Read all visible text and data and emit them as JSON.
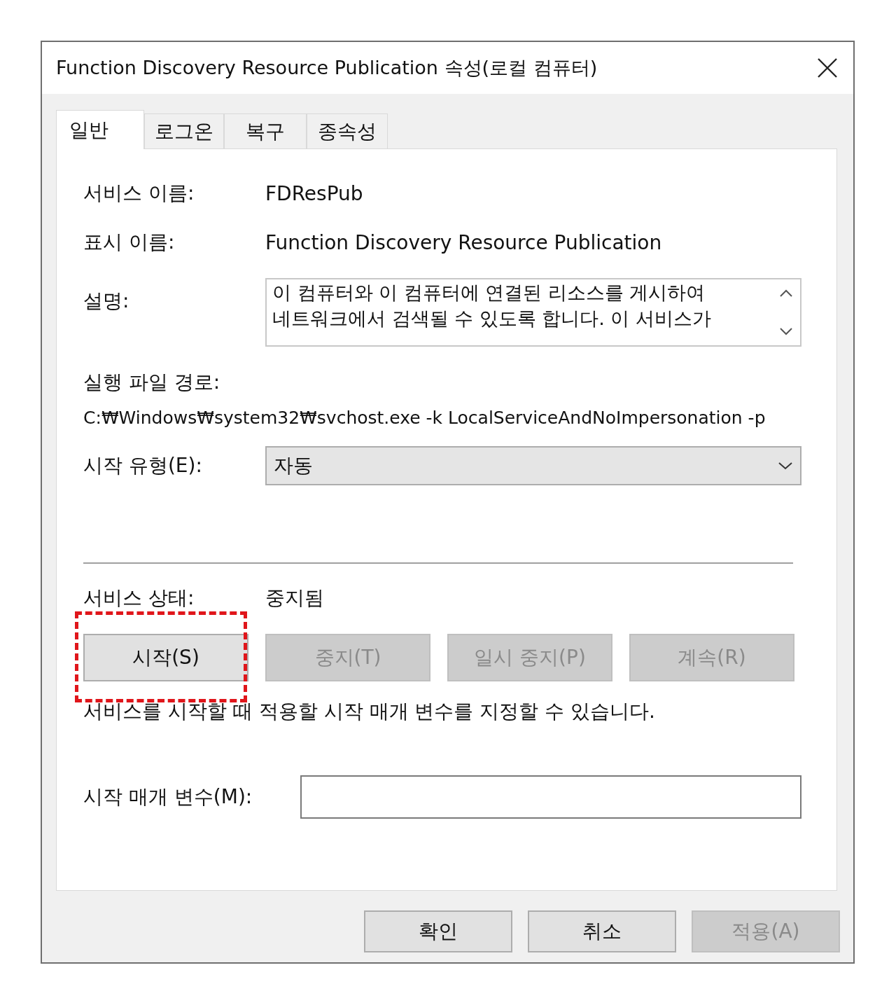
{
  "window": {
    "title": "Function Discovery Resource Publication 속성(로컬 컴퓨터)"
  },
  "tabs": [
    {
      "label": "일반",
      "selected": true
    },
    {
      "label": "로그온",
      "selected": false
    },
    {
      "label": "복구",
      "selected": false
    },
    {
      "label": "종속성",
      "selected": false
    }
  ],
  "service_name": {
    "label": "서비스 이름:",
    "value": "FDResPub"
  },
  "display_name": {
    "label": "표시 이름:",
    "value": "Function Discovery Resource Publication"
  },
  "description": {
    "label": "설명:",
    "lines": [
      "이 컴퓨터와 이 컴퓨터에 연결된 리소스를 게시하여",
      "네트워크에서 검색될 수 있도록 합니다. 이 서비스가"
    ]
  },
  "executable_path": {
    "label": "실행 파일 경로:",
    "value": "C:₩Windows₩system32₩svchost.exe -k LocalServiceAndNoImpersonation -p"
  },
  "startup_type": {
    "label": "시작 유형(E):",
    "value": "자동"
  },
  "service_status": {
    "label": "서비스 상태:",
    "value": "중지됨"
  },
  "service_buttons": [
    {
      "label": "시작(S)",
      "disabled": false,
      "highlighted": true
    },
    {
      "label": "중지(T)",
      "disabled": true,
      "highlighted": false
    },
    {
      "label": "일시 중지(P)",
      "disabled": true,
      "highlighted": false
    },
    {
      "label": "계속(R)",
      "disabled": true,
      "highlighted": false
    }
  ],
  "hint": "서비스를 시작할 때 적용할 시작 매개 변수를 지정할 수 있습니다.",
  "start_parameters": {
    "label": "시작 매개 변수(M):"
  },
  "dialog_buttons": [
    {
      "label": "확인",
      "disabled": false
    },
    {
      "label": "취소",
      "disabled": false
    },
    {
      "label": "적용(A)",
      "disabled": true
    }
  ]
}
